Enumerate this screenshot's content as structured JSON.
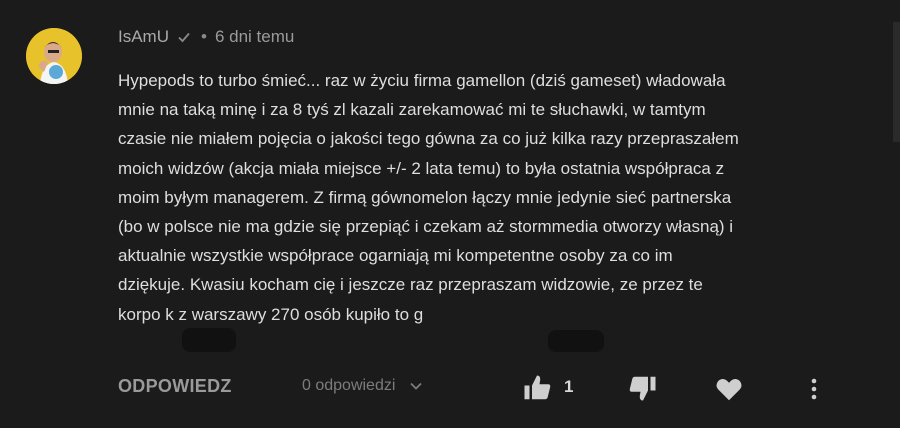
{
  "comment": {
    "author": "IsAmU",
    "separator": "•",
    "timestamp": "6 dni temu",
    "text": "Hypepods to turbo śmieć... raz w życiu firma gamellon (dziś gameset) władowała\nmnie na taką minę i za 8 tyś zl kazali zarekamować mi te słuchawki, w tamtym\nczasie nie miałem pojęcia o jakości tego gówna za co już kilka razy przepraszałem\nmoich widzów (akcja miała miejsce +/- 2 lata temu) to była ostatnia współpraca z\nmoim byłym managerem. Z firmą gównomelon łączy mnie jedynie sieć partnerska\n(bo w polsce nie ma gdzie się przepiąć i czekam aż stormmedia otworzy własną) i\naktualnie wszystkie współprace ogarniają mi kompetentne osoby za co im\ndziękuje. Kwasiu kocham cię i jeszcze raz przepraszam widzowie, ze przez te\nkorpo k        z warszawy 270 osób kupiło to g"
  },
  "actions": {
    "reply_label": "ODPOWIEDZ",
    "replies_label": "0 odpowiedzi",
    "like_count": "1"
  },
  "icons": {
    "verified": "check-icon",
    "replies_toggle": "chevron-down-icon",
    "like": "thumbs-up-icon",
    "dislike": "thumbs-down-icon",
    "heart": "heart-icon",
    "more": "more-vertical-icon"
  },
  "colors": {
    "background": "#1b1b1b",
    "avatar_bg": "#e7c22a",
    "text": "#dedede",
    "muted": "#9a9a9a"
  }
}
